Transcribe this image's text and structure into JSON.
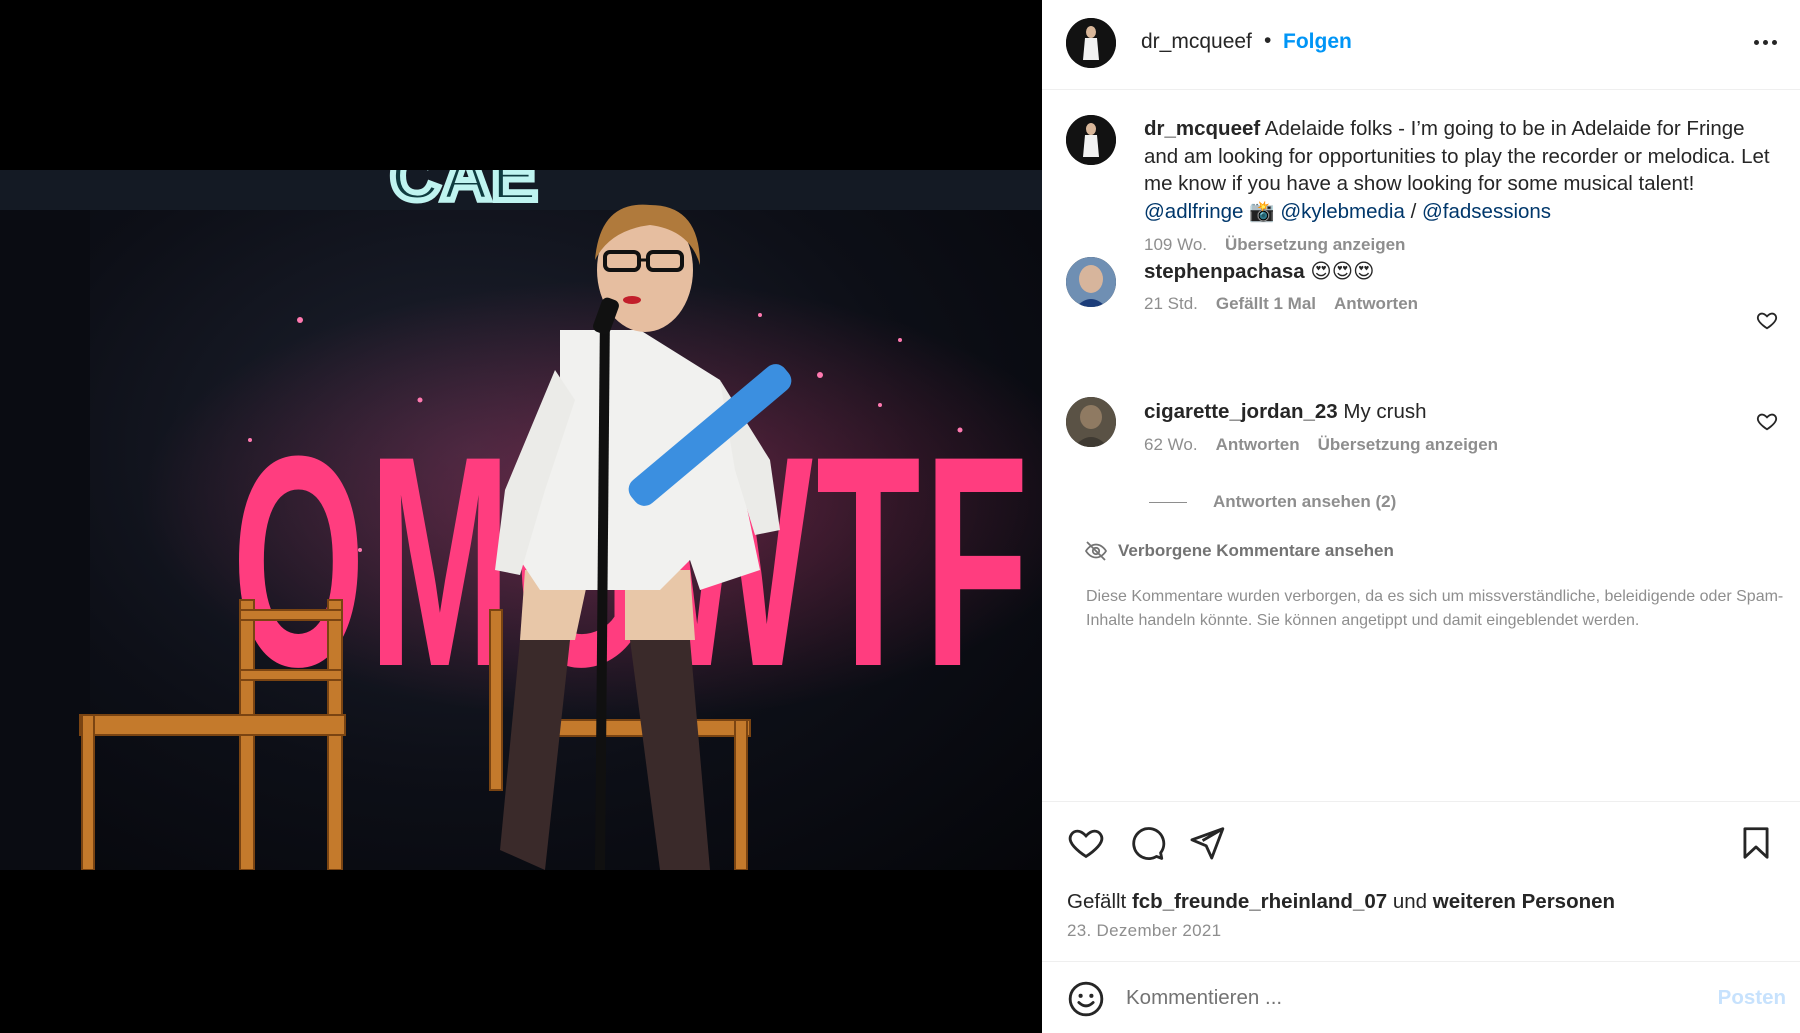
{
  "post": {
    "author": "dr_mcqueef",
    "separator": "•",
    "follow_label": "Folgen",
    "more_icon": "more-horizontal-icon"
  },
  "photo": {
    "sign_text": "OMGWTF",
    "top_sign_text": "CAE",
    "colors": {
      "sign": "#ff3d7f",
      "melodica": "#3b8fe0",
      "background": "#0d0f17"
    }
  },
  "caption": {
    "username": "dr_mcqueef",
    "text": " Adelaide folks - I’m going to be in Adelaide for Fringe and am looking for opportunities to play the recorder or melodica. Let me know if you have a show looking for some musical talent! ",
    "mention_1": "@adlfringe",
    "camera_emoji": " 📸 ",
    "mention_2": "@kylebmedia",
    "slash": " / ",
    "mention_3": "@fadsessions",
    "time": "109 Wo.",
    "translate": "Übersetzung anzeigen"
  },
  "comments": [
    {
      "username": "stephenpachasa",
      "text": " 😍😍😍",
      "time": "21 Std.",
      "likes": "Gefällt 1 Mal",
      "reply": "Antworten"
    },
    {
      "username": "cigarette_jordan_23",
      "text": " My crush",
      "time": "62 Wo.",
      "reply": "Antworten",
      "translate": "Übersetzung anzeigen",
      "view_replies": "Antworten ansehen (2)"
    }
  ],
  "hidden": {
    "link": "Verborgene Kommentare ansehen",
    "note": "Diese Kommentare wurden verborgen, da es sich um missverständliche, beleidigende oder Spam-Inhalte handeln könnte. Sie können angetippt und damit eingeblendet werden."
  },
  "likes": {
    "prefix": "Gefällt ",
    "user": "fcb_freunde_rheinland_07",
    "middle": " und ",
    "rest": "weiteren Personen"
  },
  "date": "23. Dezember 2021",
  "comment_box": {
    "placeholder": "Kommentieren ...",
    "post_label": "Posten"
  },
  "colors": {
    "accent": "#0095f6",
    "mention": "#00376b",
    "secondary_text": "#8e8e8e",
    "post_disabled": "#c7e2fd"
  }
}
